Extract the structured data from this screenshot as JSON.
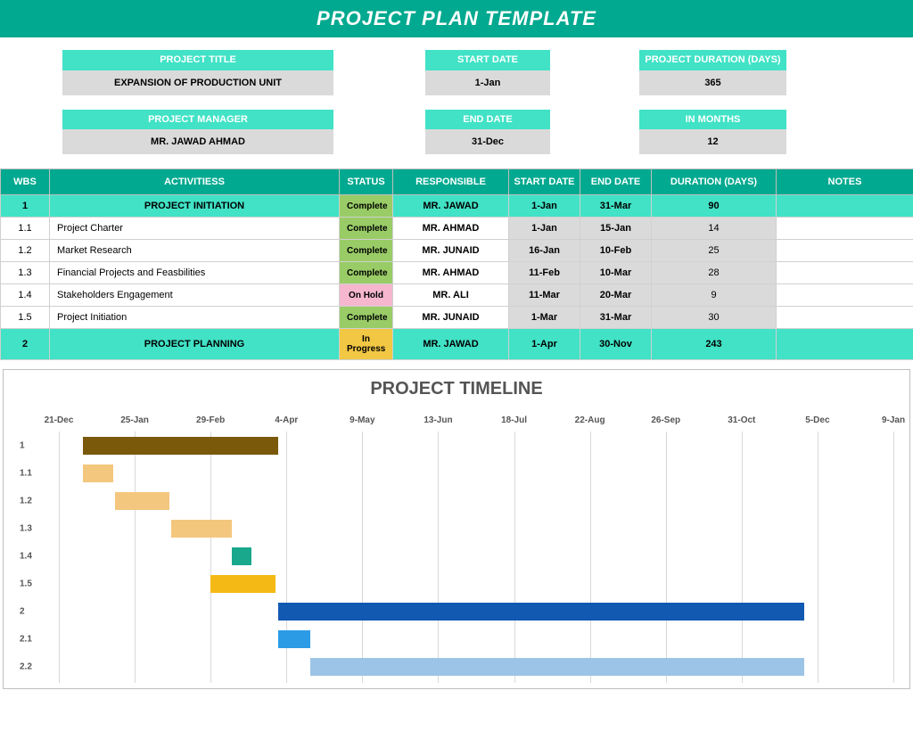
{
  "title": "PROJECT PLAN TEMPLATE",
  "meta": {
    "row1": {
      "title_label": "PROJECT TITLE",
      "title_value": "EXPANSION OF PRODUCTION UNIT",
      "start_label": "START DATE",
      "start_value": "1-Jan",
      "dur_label": "PROJECT DURATION (DAYS)",
      "dur_value": "365"
    },
    "row2": {
      "mgr_label": "PROJECT MANAGER",
      "mgr_value": "MR. JAWAD AHMAD",
      "end_label": "END DATE",
      "end_value": "31-Dec",
      "months_label": "IN MONTHS",
      "months_value": "12"
    }
  },
  "columns": {
    "wbs": "WBS",
    "act": "ACTIVITIESS",
    "stat": "STATUS",
    "resp": "RESPONSIBLE",
    "sd": "START DATE",
    "ed": "END DATE",
    "dur": "DURATION (DAYS)",
    "notes": "NOTES"
  },
  "rows": [
    {
      "type": "phase",
      "wbs": "1",
      "act": "PROJECT INITIATION",
      "stat": "Complete",
      "stat_cls": "complete",
      "resp": "MR. JAWAD",
      "sd": "1-Jan",
      "ed": "31-Mar",
      "dur": "90",
      "notes": ""
    },
    {
      "type": "task",
      "wbs": "1.1",
      "act": "Project Charter",
      "stat": "Complete",
      "stat_cls": "complete",
      "resp": "MR. AHMAD",
      "sd": "1-Jan",
      "ed": "15-Jan",
      "dur": "14",
      "notes": ""
    },
    {
      "type": "task",
      "wbs": "1.2",
      "act": "Market Research",
      "stat": "Complete",
      "stat_cls": "complete",
      "resp": "MR. JUNAID",
      "sd": "16-Jan",
      "ed": "10-Feb",
      "dur": "25",
      "notes": ""
    },
    {
      "type": "task",
      "wbs": "1.3",
      "act": "Financial Projects and Feasbilities",
      "stat": "Complete",
      "stat_cls": "complete",
      "resp": "MR. AHMAD",
      "sd": "11-Feb",
      "ed": "10-Mar",
      "dur": "28",
      "notes": ""
    },
    {
      "type": "task",
      "wbs": "1.4",
      "act": "Stakeholders Engagement",
      "stat": "On Hold",
      "stat_cls": "hold",
      "resp": "MR. ALI",
      "sd": "11-Mar",
      "ed": "20-Mar",
      "dur": "9",
      "notes": ""
    },
    {
      "type": "task",
      "wbs": "1.5",
      "act": "Project Initiation",
      "stat": "Complete",
      "stat_cls": "complete",
      "resp": "MR. JUNAID",
      "sd": "1-Mar",
      "ed": "31-Mar",
      "dur": "30",
      "notes": ""
    },
    {
      "type": "phase",
      "wbs": "2",
      "act": "PROJECT PLANNING",
      "stat": "In Progress",
      "stat_cls": "progress",
      "resp": "MR. JAWAD",
      "sd": "1-Apr",
      "ed": "30-Nov",
      "dur": "243",
      "notes": ""
    }
  ],
  "timeline_title": "PROJECT TIMELINE",
  "chart_data": {
    "type": "bar",
    "title": "PROJECT TIMELINE",
    "xlabel": "",
    "ylabel": "",
    "x_ticks": [
      {
        "label": "21-Dec",
        "day": -11
      },
      {
        "label": "25-Jan",
        "day": 24
      },
      {
        "label": "29-Feb",
        "day": 59
      },
      {
        "label": "4-Apr",
        "day": 94
      },
      {
        "label": "9-May",
        "day": 129
      },
      {
        "label": "13-Jun",
        "day": 164
      },
      {
        "label": "18-Jul",
        "day": 199
      },
      {
        "label": "22-Aug",
        "day": 234
      },
      {
        "label": "26-Sep",
        "day": 269
      },
      {
        "label": "31-Oct",
        "day": 304
      },
      {
        "label": "5-Dec",
        "day": 339
      },
      {
        "label": "9-Jan",
        "day": 374
      }
    ],
    "x_range": [
      -11,
      374
    ],
    "series": [
      {
        "name": "1",
        "start": 0,
        "duration": 90,
        "color": "#7A5A0A"
      },
      {
        "name": "1.1",
        "start": 0,
        "duration": 14,
        "color": "#F3C77E"
      },
      {
        "name": "1.2",
        "start": 15,
        "duration": 25,
        "color": "#F3C77E"
      },
      {
        "name": "1.3",
        "start": 41,
        "duration": 28,
        "color": "#F3C77E"
      },
      {
        "name": "1.4",
        "start": 69,
        "duration": 9,
        "color": "#19A88C"
      },
      {
        "name": "1.5",
        "start": 59,
        "duration": 30,
        "color": "#F5B915"
      },
      {
        "name": "2",
        "start": 90,
        "duration": 243,
        "color": "#1259B1"
      },
      {
        "name": "2.1",
        "start": 90,
        "duration": 15,
        "color": "#2C9BE6"
      },
      {
        "name": "2.2",
        "start": 105,
        "duration": 228,
        "color": "#9CC4E6"
      }
    ]
  }
}
